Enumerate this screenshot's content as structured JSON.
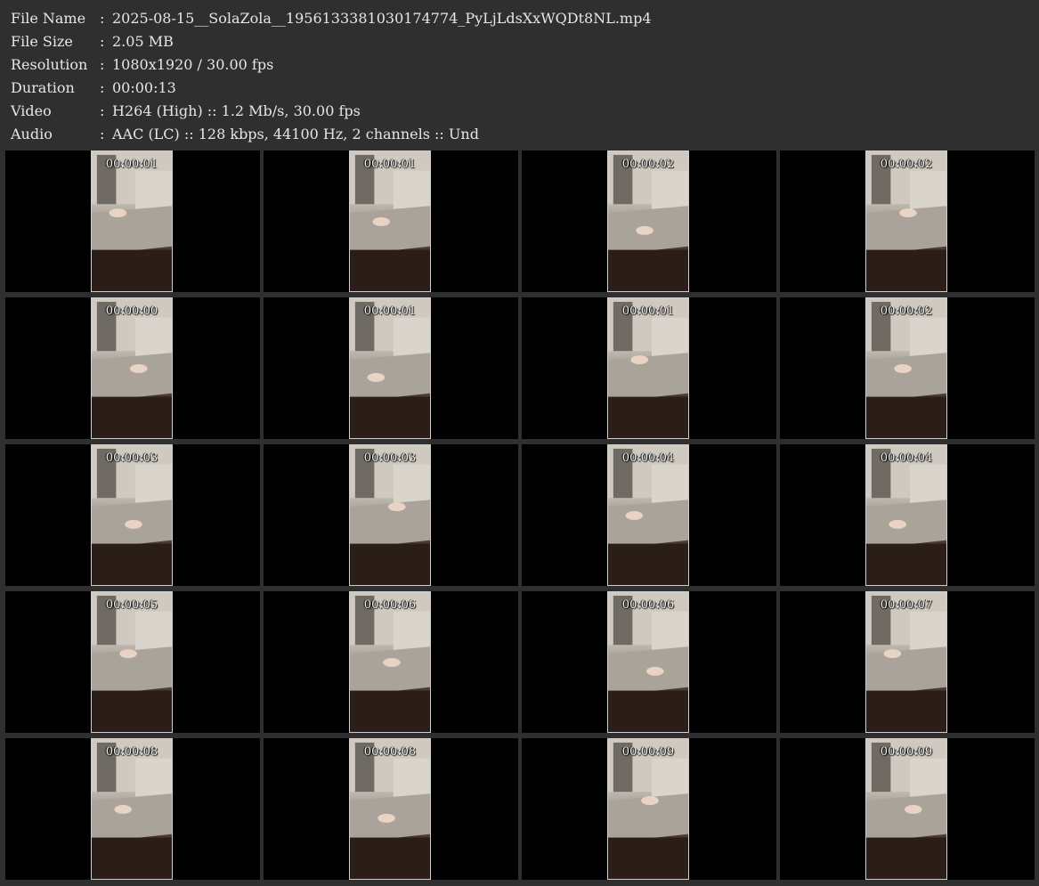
{
  "info": [
    {
      "key": "File Name",
      "value": "2025-08-15__SolaZola__1956133381030174774_PyLjLdsXxWQDt8NL.mp4"
    },
    {
      "key": "File Size",
      "value": "2.05 MB"
    },
    {
      "key": "Resolution",
      "value": "1080x1920 / 30.00 fps"
    },
    {
      "key": "Duration",
      "value": "00:00:13"
    },
    {
      "key": "Video",
      "value": "H264 (High) :: 1.2 Mb/s, 30.00 fps"
    },
    {
      "key": "Audio",
      "value": "AAC (LC) :: 128 kbps, 44100 Hz, 2 channels :: Und"
    }
  ],
  "separator": ":",
  "thumbnails": [
    "00:00:01",
    "00:00:01",
    "00:00:02",
    "00:00:02",
    "00:00:00",
    "00:00:01",
    "00:00:01",
    "00:00:02",
    "00:00:03",
    "00:00:03",
    "00:00:04",
    "00:00:04",
    "00:00:05",
    "00:00:06",
    "00:00:06",
    "00:00:07",
    "00:00:08",
    "00:00:08",
    "00:00:09",
    "00:00:09"
  ]
}
